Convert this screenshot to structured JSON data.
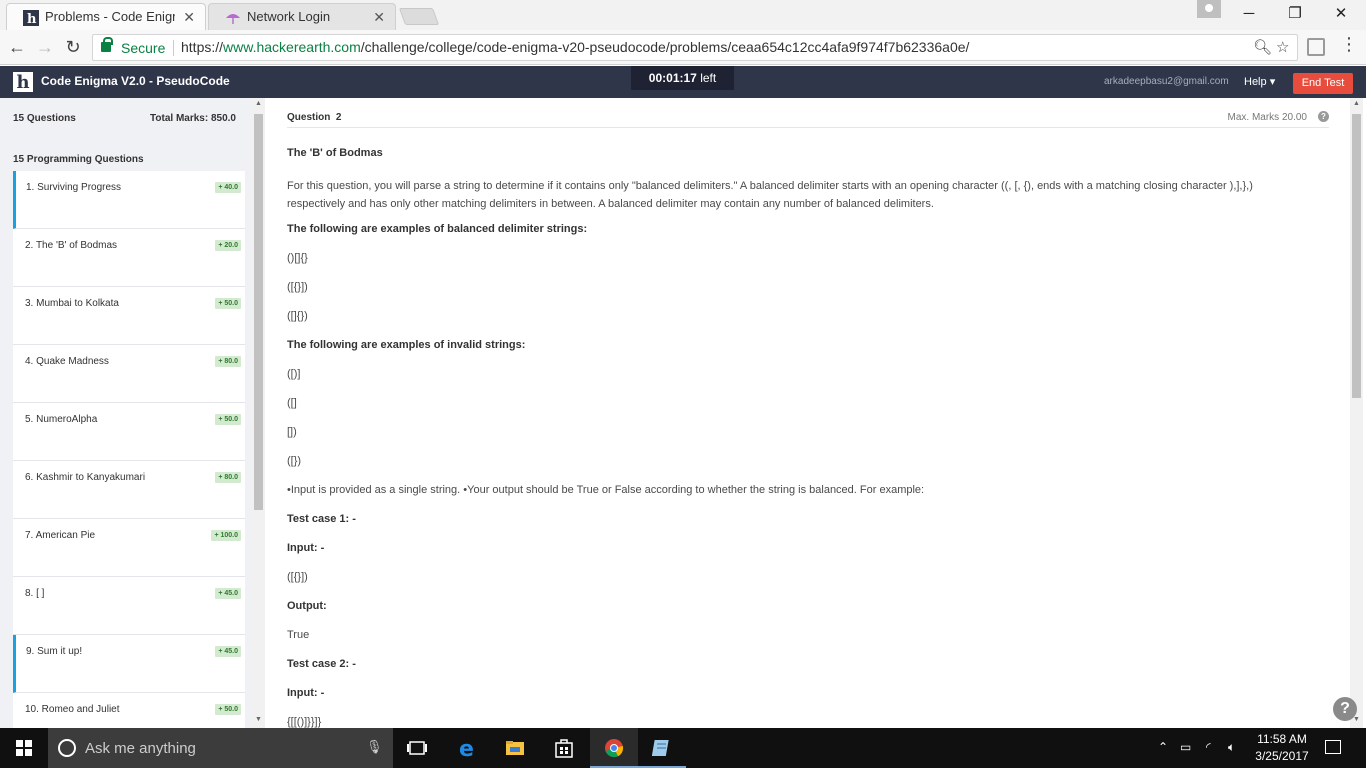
{
  "browser": {
    "tabs": [
      {
        "label": "Problems - Code Enigma",
        "active": true
      },
      {
        "label": "Network Login",
        "active": false
      }
    ],
    "secure_label": "Secure",
    "url_scheme": "https://",
    "url_host": "www.hackerearth.com",
    "url_path": "/challenge/college/code-enigma-v20-pseudocode/problems/ceaa654c12cc4afa9f974f7b62336a0e/"
  },
  "header": {
    "logo_letter": "h",
    "contest_title": "Code Enigma V2.0 - PseudoCode",
    "timer_value": "00:01:17",
    "timer_suffix": "left",
    "user_email": "arkadeepbasu2@gmail.com",
    "help_label": "Help",
    "end_test_label": "End Test"
  },
  "sidebar": {
    "question_count": "15 Questions",
    "total_marks": "Total Marks: 850.0",
    "group_label": "15 Programming Questions",
    "questions": [
      {
        "label": "1. Surviving Progress",
        "marks": "+ 40.0"
      },
      {
        "label": "2. The 'B' of Bodmas",
        "marks": "+ 20.0"
      },
      {
        "label": "3. Mumbai to Kolkata",
        "marks": "+ 50.0"
      },
      {
        "label": "4. Quake Madness",
        "marks": "+ 80.0"
      },
      {
        "label": "5. NumeroAlpha",
        "marks": "+ 50.0"
      },
      {
        "label": "6. Kashmir to Kanyakumari",
        "marks": "+ 80.0"
      },
      {
        "label": "7. American Pie",
        "marks": "+ 100.0"
      },
      {
        "label": "8. [ ]",
        "marks": "+ 45.0"
      },
      {
        "label": "9. Sum it up!",
        "marks": "+ 45.0"
      },
      {
        "label": "10. Romeo and Juliet",
        "marks": "+ 50.0"
      }
    ]
  },
  "question": {
    "number_label": "Question",
    "number": "2",
    "max_marks": "Max. Marks 20.00",
    "title": "The 'B' of Bodmas",
    "intro_line1": "For this question, you will parse a string to determine if it contains only \"balanced delimiters.\" A balanced delimiter starts with an opening character ((, [, {), ends with a matching closing character ),],},)",
    "intro_line2": "respectively and has only other matching delimiters in between. A balanced delimiter may contain any number of balanced delimiters.",
    "balanced_heading": "The following are examples of balanced delimiter strings:",
    "balanced_examples": [
      "()[]{}",
      "([{}])",
      "([]{})"
    ],
    "invalid_heading": "The following are examples of invalid strings:",
    "invalid_examples": [
      "([)]",
      "([]",
      "[])",
      "([})"
    ],
    "io_note": "•Input is provided as a single string. •Your output should be True or False according to whether the string is balanced. For example:",
    "test1_label": "Test case 1: -",
    "input_label": "Input: -",
    "test1_input": "([{}])",
    "output_label": "Output:",
    "test1_output": "True",
    "test2_label": "Test case 2: -",
    "test2_input": "{[[()]}}]}"
  },
  "taskbar": {
    "search_placeholder": "Ask me anything",
    "time": "11:58 AM",
    "date": "3/25/2017"
  }
}
